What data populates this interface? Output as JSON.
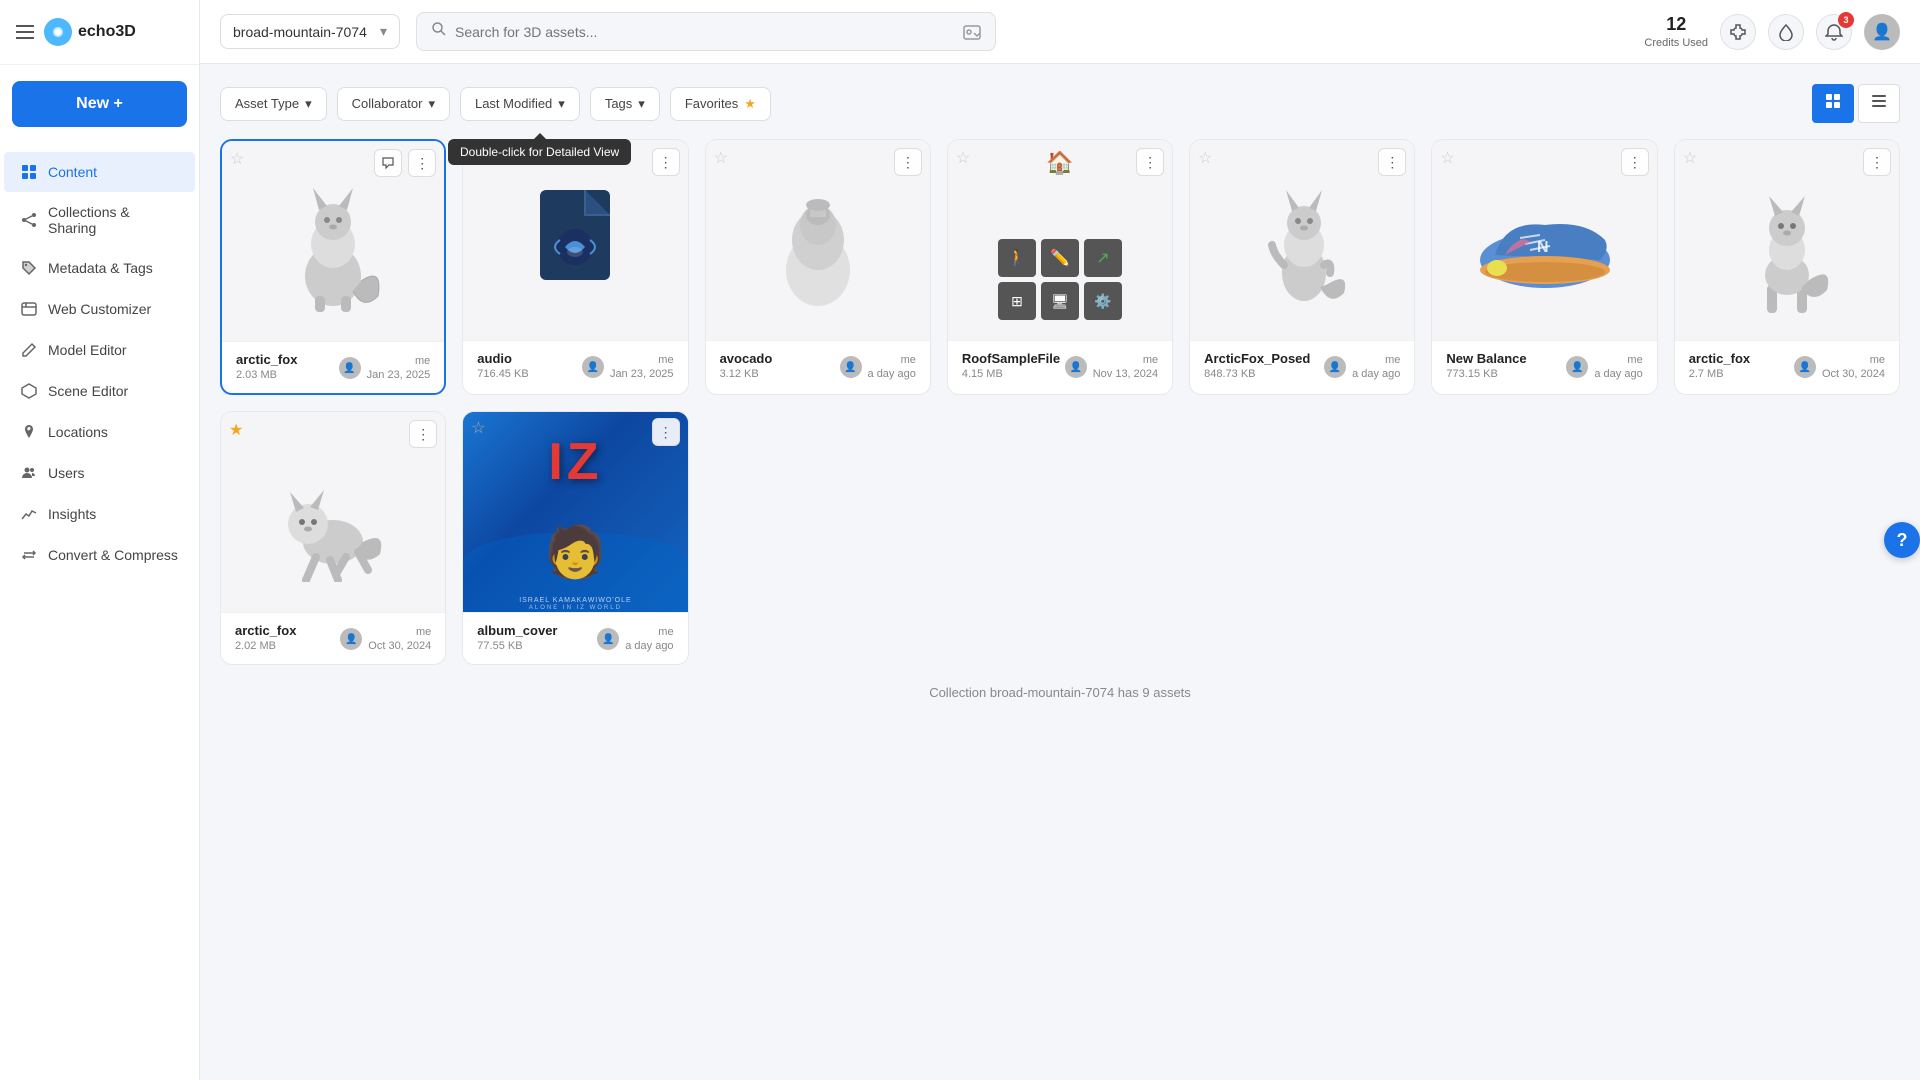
{
  "logo": {
    "text": "echo3D"
  },
  "workspace": {
    "name": "broad-mountain-7074"
  },
  "search": {
    "placeholder": "Search for 3D assets..."
  },
  "credits": {
    "count": "12",
    "label": "Credits Used"
  },
  "notifications": {
    "badge": "3"
  },
  "new_button": {
    "label": "New +"
  },
  "sidebar": {
    "items": [
      {
        "id": "content",
        "label": "Content",
        "icon": "grid",
        "active": true
      },
      {
        "id": "collections",
        "label": "Collections & Sharing",
        "icon": "share"
      },
      {
        "id": "metadata",
        "label": "Metadata & Tags",
        "icon": "tag"
      },
      {
        "id": "web-customizer",
        "label": "Web Customizer",
        "icon": "web"
      },
      {
        "id": "model-editor",
        "label": "Model Editor",
        "icon": "edit"
      },
      {
        "id": "scene-editor",
        "label": "Scene Editor",
        "icon": "scene"
      },
      {
        "id": "locations",
        "label": "Locations",
        "icon": "pin"
      },
      {
        "id": "users",
        "label": "Users",
        "icon": "users"
      },
      {
        "id": "insights",
        "label": "Insights",
        "icon": "insights"
      },
      {
        "id": "convert",
        "label": "Convert & Compress",
        "icon": "convert"
      }
    ]
  },
  "toolbar": {
    "filters": [
      {
        "id": "asset-type",
        "label": "Asset Type",
        "has_dropdown": true
      },
      {
        "id": "collaborator",
        "label": "Collaborator",
        "has_dropdown": true
      },
      {
        "id": "last-modified",
        "label": "Last Modified",
        "has_dropdown": true
      },
      {
        "id": "tags",
        "label": "Tags",
        "has_dropdown": true
      },
      {
        "id": "favorites",
        "label": "Favorites",
        "has_star": true
      }
    ],
    "tooltip": "Double-click for Detailed View",
    "view_grid_label": "⊞",
    "view_list_label": "☰"
  },
  "assets": [
    {
      "id": 1,
      "name": "arctic_fox",
      "size": "2.03 MB",
      "user": "me",
      "date": "Jan 23, 2025",
      "starred": false,
      "selected": true,
      "thumb_type": "fox3d_sitting",
      "bg": "#f5f5f8"
    },
    {
      "id": 2,
      "name": "audio",
      "size": "716.45 KB",
      "user": "me",
      "date": "Jan 23, 2025",
      "starred": false,
      "selected": false,
      "thumb_type": "audio_file",
      "bg": "#f5f5f8"
    },
    {
      "id": 3,
      "name": "avocado",
      "size": "3.12 KB",
      "user": "me",
      "date": "a day ago",
      "starred": false,
      "selected": false,
      "thumb_type": "avocado3d",
      "bg": "#f5f5f8"
    },
    {
      "id": 4,
      "name": "RoofSampleFile",
      "size": "4.15 MB",
      "user": "me",
      "date": "Nov 13, 2024",
      "starred": false,
      "selected": false,
      "thumb_type": "roof_ui",
      "bg": "#f5f5f8"
    },
    {
      "id": 5,
      "name": "ArcticFox_Posed",
      "size": "848.73 KB",
      "user": "me",
      "date": "a day ago",
      "starred": false,
      "selected": false,
      "thumb_type": "fox3d_posed",
      "bg": "#f5f5f8"
    },
    {
      "id": 6,
      "name": "New Balance",
      "size": "773.15 KB",
      "user": "me",
      "date": "a day ago",
      "starred": false,
      "selected": false,
      "thumb_type": "shoe",
      "bg": "#f5f5f8"
    },
    {
      "id": 7,
      "name": "arctic_fox",
      "size": "2.7 MB",
      "user": "me",
      "date": "Oct 30, 2024",
      "starred": false,
      "selected": false,
      "thumb_type": "fox3d_standing",
      "bg": "#f5f5f8"
    },
    {
      "id": 8,
      "name": "arctic_fox",
      "size": "2.02 MB",
      "user": "me",
      "date": "Oct 30, 2024",
      "starred": true,
      "selected": false,
      "thumb_type": "fox3d_walking",
      "bg": "#f5f5f8"
    },
    {
      "id": 9,
      "name": "album_cover",
      "size": "77.55 KB",
      "user": "me",
      "date": "a day ago",
      "starred": false,
      "selected": false,
      "thumb_type": "album_iz",
      "bg": "#2196f3"
    }
  ],
  "collection_footer": "Collection broad-mountain-7074 has 9 assets"
}
